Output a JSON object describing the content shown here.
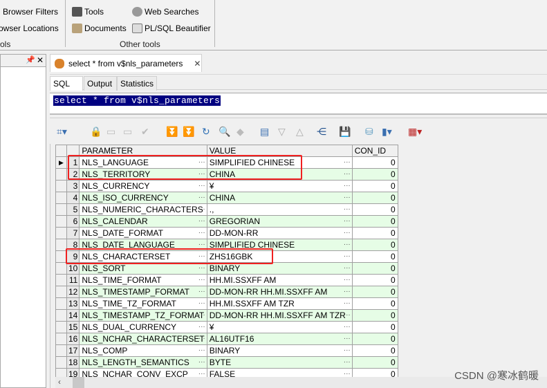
{
  "ribbon": {
    "items": [
      {
        "label": "Browser Filters",
        "icon": "filter-icon"
      },
      {
        "label": "owser Locations",
        "icon": "location-icon"
      },
      {
        "label": "Tools",
        "icon": "toolbox-icon"
      },
      {
        "label": "Documents",
        "icon": "documents-icon"
      },
      {
        "label": "Web Searches",
        "icon": "globe-icon"
      },
      {
        "label": "PL/SQL Beautifier",
        "icon": "beautifier-icon"
      }
    ],
    "group_left": "ols",
    "group_other": "Other tools"
  },
  "doc_tab": {
    "label": "select * from v$nls_parameters",
    "close": "✕"
  },
  "left_panel": {
    "pin": "📌",
    "close": "✕"
  },
  "sql_tabs": [
    "SQL",
    "Output",
    "Statistics"
  ],
  "editor": {
    "text": "select * from v$nls_parameters"
  },
  "grid": {
    "columns": [
      "PARAMETER",
      "VALUE",
      "CON_ID"
    ],
    "rows": [
      [
        "NLS_LANGUAGE",
        "SIMPLIFIED CHINESE",
        "0"
      ],
      [
        "NLS_TERRITORY",
        "CHINA",
        "0"
      ],
      [
        "NLS_CURRENCY",
        "¥",
        "0"
      ],
      [
        "NLS_ISO_CURRENCY",
        "CHINA",
        "0"
      ],
      [
        "NLS_NUMERIC_CHARACTERS",
        ".,",
        "0"
      ],
      [
        "NLS_CALENDAR",
        "GREGORIAN",
        "0"
      ],
      [
        "NLS_DATE_FORMAT",
        "DD-MON-RR",
        "0"
      ],
      [
        "NLS_DATE_LANGUAGE",
        "SIMPLIFIED CHINESE",
        "0"
      ],
      [
        "NLS_CHARACTERSET",
        "ZHS16GBK",
        "0"
      ],
      [
        "NLS_SORT",
        "BINARY",
        "0"
      ],
      [
        "NLS_TIME_FORMAT",
        "HH.MI.SSXFF AM",
        "0"
      ],
      [
        "NLS_TIMESTAMP_FORMAT",
        "DD-MON-RR HH.MI.SSXFF AM",
        "0"
      ],
      [
        "NLS_TIME_TZ_FORMAT",
        "HH.MI.SSXFF AM TZR",
        "0"
      ],
      [
        "NLS_TIMESTAMP_TZ_FORMAT",
        "DD-MON-RR HH.MI.SSXFF AM TZR",
        "0"
      ],
      [
        "NLS_DUAL_CURRENCY",
        "¥",
        "0"
      ],
      [
        "NLS_NCHAR_CHARACTERSET",
        "AL16UTF16",
        "0"
      ],
      [
        "NLS_COMP",
        "BINARY",
        "0"
      ],
      [
        "NLS_LENGTH_SEMANTICS",
        "BYTE",
        "0"
      ],
      [
        "NLS_NCHAR_CONV_EXCP",
        "FALSE",
        "0"
      ]
    ],
    "selected_row": 1,
    "highlight_color": "#f02020",
    "stripe_color": "#e6fde6"
  },
  "watermark": "CSDN @寒冰鹤暖"
}
